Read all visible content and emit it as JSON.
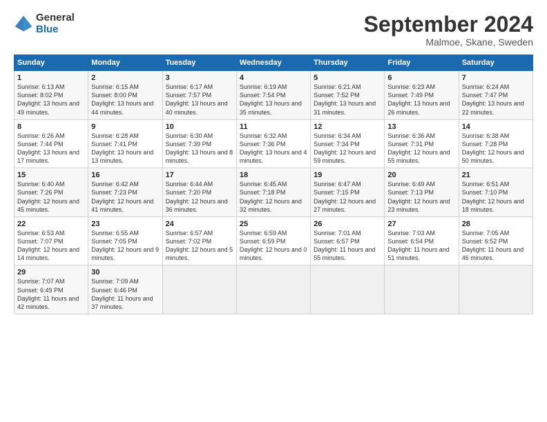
{
  "header": {
    "logo_general": "General",
    "logo_blue": "Blue",
    "month_title": "September 2024",
    "subtitle": "Malmoe, Skane, Sweden"
  },
  "weekdays": [
    "Sunday",
    "Monday",
    "Tuesday",
    "Wednesday",
    "Thursday",
    "Friday",
    "Saturday"
  ],
  "weeks": [
    [
      {
        "day": "1",
        "sunrise": "6:13 AM",
        "sunset": "8:02 PM",
        "daylight": "13 hours and 49 minutes."
      },
      {
        "day": "2",
        "sunrise": "6:15 AM",
        "sunset": "8:00 PM",
        "daylight": "13 hours and 44 minutes."
      },
      {
        "day": "3",
        "sunrise": "6:17 AM",
        "sunset": "7:57 PM",
        "daylight": "13 hours and 40 minutes."
      },
      {
        "day": "4",
        "sunrise": "6:19 AM",
        "sunset": "7:54 PM",
        "daylight": "13 hours and 35 minutes."
      },
      {
        "day": "5",
        "sunrise": "6:21 AM",
        "sunset": "7:52 PM",
        "daylight": "13 hours and 31 minutes."
      },
      {
        "day": "6",
        "sunrise": "6:23 AM",
        "sunset": "7:49 PM",
        "daylight": "13 hours and 26 minutes."
      },
      {
        "day": "7",
        "sunrise": "6:24 AM",
        "sunset": "7:47 PM",
        "daylight": "13 hours and 22 minutes."
      }
    ],
    [
      {
        "day": "8",
        "sunrise": "6:26 AM",
        "sunset": "7:44 PM",
        "daylight": "13 hours and 17 minutes."
      },
      {
        "day": "9",
        "sunrise": "6:28 AM",
        "sunset": "7:41 PM",
        "daylight": "13 hours and 13 minutes."
      },
      {
        "day": "10",
        "sunrise": "6:30 AM",
        "sunset": "7:39 PM",
        "daylight": "13 hours and 8 minutes."
      },
      {
        "day": "11",
        "sunrise": "6:32 AM",
        "sunset": "7:36 PM",
        "daylight": "13 hours and 4 minutes."
      },
      {
        "day": "12",
        "sunrise": "6:34 AM",
        "sunset": "7:34 PM",
        "daylight": "12 hours and 59 minutes."
      },
      {
        "day": "13",
        "sunrise": "6:36 AM",
        "sunset": "7:31 PM",
        "daylight": "12 hours and 55 minutes."
      },
      {
        "day": "14",
        "sunrise": "6:38 AM",
        "sunset": "7:28 PM",
        "daylight": "12 hours and 50 minutes."
      }
    ],
    [
      {
        "day": "15",
        "sunrise": "6:40 AM",
        "sunset": "7:26 PM",
        "daylight": "12 hours and 45 minutes."
      },
      {
        "day": "16",
        "sunrise": "6:42 AM",
        "sunset": "7:23 PM",
        "daylight": "12 hours and 41 minutes."
      },
      {
        "day": "17",
        "sunrise": "6:44 AM",
        "sunset": "7:20 PM",
        "daylight": "12 hours and 36 minutes."
      },
      {
        "day": "18",
        "sunrise": "6:45 AM",
        "sunset": "7:18 PM",
        "daylight": "12 hours and 32 minutes."
      },
      {
        "day": "19",
        "sunrise": "6:47 AM",
        "sunset": "7:15 PM",
        "daylight": "12 hours and 27 minutes."
      },
      {
        "day": "20",
        "sunrise": "6:49 AM",
        "sunset": "7:13 PM",
        "daylight": "12 hours and 23 minutes."
      },
      {
        "day": "21",
        "sunrise": "6:51 AM",
        "sunset": "7:10 PM",
        "daylight": "12 hours and 18 minutes."
      }
    ],
    [
      {
        "day": "22",
        "sunrise": "6:53 AM",
        "sunset": "7:07 PM",
        "daylight": "12 hours and 14 minutes."
      },
      {
        "day": "23",
        "sunrise": "6:55 AM",
        "sunset": "7:05 PM",
        "daylight": "12 hours and 9 minutes."
      },
      {
        "day": "24",
        "sunrise": "6:57 AM",
        "sunset": "7:02 PM",
        "daylight": "12 hours and 5 minutes."
      },
      {
        "day": "25",
        "sunrise": "6:59 AM",
        "sunset": "6:59 PM",
        "daylight": "12 hours and 0 minutes."
      },
      {
        "day": "26",
        "sunrise": "7:01 AM",
        "sunset": "6:57 PM",
        "daylight": "11 hours and 55 minutes."
      },
      {
        "day": "27",
        "sunrise": "7:03 AM",
        "sunset": "6:54 PM",
        "daylight": "11 hours and 51 minutes."
      },
      {
        "day": "28",
        "sunrise": "7:05 AM",
        "sunset": "6:52 PM",
        "daylight": "11 hours and 46 minutes."
      }
    ],
    [
      {
        "day": "29",
        "sunrise": "7:07 AM",
        "sunset": "6:49 PM",
        "daylight": "11 hours and 42 minutes."
      },
      {
        "day": "30",
        "sunrise": "7:09 AM",
        "sunset": "6:46 PM",
        "daylight": "11 hours and 37 minutes."
      },
      null,
      null,
      null,
      null,
      null
    ]
  ]
}
